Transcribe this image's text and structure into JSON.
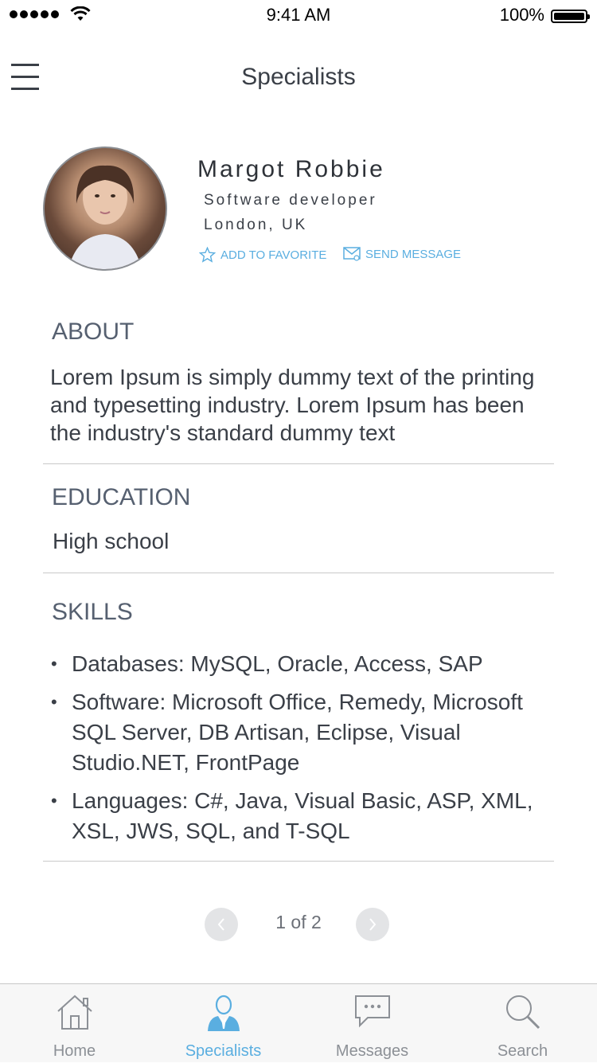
{
  "status_bar": {
    "time": "9:41 AM",
    "battery": "100%",
    "battery_level": 1.0
  },
  "header": {
    "title": "Specialists",
    "menu_icon": "hamburger-icon"
  },
  "profile": {
    "name": "Margot Robbie",
    "role": "Software developer",
    "location": "London, UK",
    "favorite_label": "ADD TO FAVORITE",
    "message_label": "SEND MESSAGE"
  },
  "about": {
    "title": "ABOUT",
    "text": "Lorem Ipsum is simply dummy text of the printing and typesetting industry. Lorem Ipsum has been the industry's standard dummy text"
  },
  "education": {
    "title": "EDUCATION",
    "value": "High school"
  },
  "skills": {
    "title": "SKILLS",
    "items": [
      "Databases: MySQL, Oracle, Access, SAP",
      "Software: Microsoft Office, Remedy, Microsoft SQL Server, DB Artisan, Eclipse, Visual Studio.NET, FrontPage",
      "Languages: C#, Java, Visual Basic, ASP, XML, XSL, JWS, SQL, and T-SQL"
    ]
  },
  "pagination": {
    "text": "1 of 2"
  },
  "tabs": [
    {
      "label": "Home",
      "icon": "home-icon",
      "active": false
    },
    {
      "label": "Specialists",
      "icon": "specialist-icon",
      "active": true
    },
    {
      "label": "Messages",
      "icon": "chat-bubble-icon",
      "active": false
    },
    {
      "label": "Search",
      "icon": "search-icon",
      "active": false
    }
  ],
  "colors": {
    "accent": "#5aaee0",
    "text": "#3a3f47",
    "section": "#566070",
    "divider": "#c9c9c9"
  }
}
